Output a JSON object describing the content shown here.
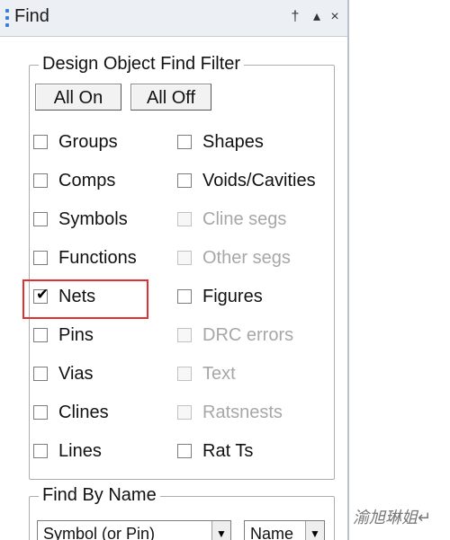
{
  "window": {
    "title": "Find",
    "pin_glyph": "†",
    "menu_glyph": "▴",
    "close_glyph": "×"
  },
  "filter": {
    "legend": "Design Object Find Filter",
    "all_on": "All On",
    "all_off": "All Off",
    "left": [
      {
        "label": "Groups",
        "checked": false,
        "enabled": true
      },
      {
        "label": "Comps",
        "checked": false,
        "enabled": true
      },
      {
        "label": "Symbols",
        "checked": false,
        "enabled": true
      },
      {
        "label": "Functions",
        "checked": false,
        "enabled": true
      },
      {
        "label": "Nets",
        "checked": true,
        "enabled": true
      },
      {
        "label": "Pins",
        "checked": false,
        "enabled": true
      },
      {
        "label": "Vias",
        "checked": false,
        "enabled": true
      },
      {
        "label": "Clines",
        "checked": false,
        "enabled": true
      },
      {
        "label": "Lines",
        "checked": false,
        "enabled": true
      }
    ],
    "right": [
      {
        "label": "Shapes",
        "checked": false,
        "enabled": true
      },
      {
        "label": "Voids/Cavities",
        "checked": false,
        "enabled": true
      },
      {
        "label": "Cline segs",
        "checked": false,
        "enabled": false
      },
      {
        "label": "Other segs",
        "checked": false,
        "enabled": false
      },
      {
        "label": "Figures",
        "checked": false,
        "enabled": true
      },
      {
        "label": "DRC errors",
        "checked": false,
        "enabled": false
      },
      {
        "label": "Text",
        "checked": false,
        "enabled": false
      },
      {
        "label": "Ratsnests",
        "checked": false,
        "enabled": false
      },
      {
        "label": "Rat Ts",
        "checked": false,
        "enabled": true
      }
    ],
    "check_glyph": "✔"
  },
  "find_by_name": {
    "legend": "Find By Name",
    "type_value": "Symbol (or Pin)",
    "mode_value": "Name",
    "arrow_glyph": "▼"
  },
  "watermark": "渝旭琳姐↵",
  "colors": {
    "highlight": "#e03030",
    "grip": "#3a7fd0"
  }
}
